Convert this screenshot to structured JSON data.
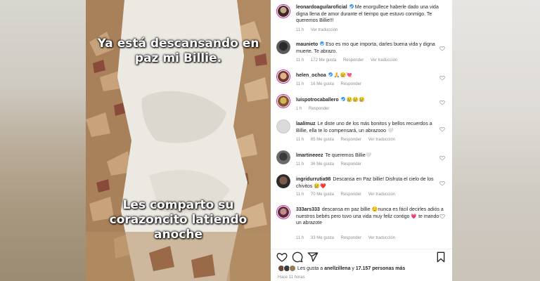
{
  "photo": {
    "caption_top": [
      "Ya está descansando en",
      "paz mi Billie."
    ],
    "caption_bottom": [
      "Les comparto su",
      "corazoncito latiendo",
      "anoche"
    ]
  },
  "comments": [
    {
      "user": "leonardoaguilaroficial",
      "verified": true,
      "text": "Me enorgullece haberle dado una vida digna llena de amor durante el tiempo que estuvo conmigo. Te queremos Billie!!!",
      "time": "11 h",
      "likes": "",
      "reply": "",
      "translate": "Ver traducción",
      "heart": false
    },
    {
      "user": "maunieto",
      "verified": true,
      "text": "Eso es mo que importa, darles buena vida y digna muerte. Te abrazo.",
      "time": "11 h",
      "likes": "172 Me gusta",
      "reply": "Responder",
      "translate": "Ver traducción",
      "heart": true
    },
    {
      "user": "helen_ochoa",
      "verified": true,
      "text": "🙏😢💘",
      "time": "11 h",
      "likes": "16 Me gusta",
      "reply": "Responder",
      "translate": "",
      "heart": true
    },
    {
      "user": "luispotrocaballero",
      "verified": true,
      "text": "😢😢😢",
      "time": "1 h",
      "likes": "",
      "reply": "Responder",
      "translate": "",
      "heart": true
    },
    {
      "user": "laalimuz",
      "verified": false,
      "text": "Le diste uno de los más bonitos y bellos recuerdos a Billie, ella te lo compensará, un abrazooo 🤍",
      "time": "11 h",
      "likes": "65 Me gusta",
      "reply": "Responder",
      "translate": "Ver traducción",
      "heart": true
    },
    {
      "user": "lmartineeez",
      "verified": false,
      "text": "Te queremos Billie🤍",
      "time": "11 h",
      "likes": "36 Me gusta",
      "reply": "Responder",
      "translate": "",
      "heart": true
    },
    {
      "user": "ingridurrutia98",
      "verified": false,
      "text": "Descansa en Paz billie! Disfruta el cielo de los chivitos 😢❤️",
      "time": "11 h",
      "likes": "70 Me gusta",
      "reply": "Responder",
      "translate": "Ver traducción",
      "heart": true
    },
    {
      "user": "333ars333",
      "verified": false,
      "text": "descansa en paz billie 😌nunca es fácil decirles adiós a nuestros bebés pero tuvo una vida muy feliz contigo 💗 te mando un abrazote",
      "time": "11 h",
      "likes": "33 Me gusta",
      "reply": "Responder",
      "translate": "Ver traducción",
      "heart": true
    }
  ],
  "likes_line": {
    "prefix": "Les gusta a",
    "user": "anellzillena",
    "middle": "y",
    "count": "17.157 personas más"
  },
  "time_ago": "Hace 11 horas",
  "icons": [
    "heart-icon",
    "comment-icon",
    "share-icon",
    "save-icon"
  ]
}
